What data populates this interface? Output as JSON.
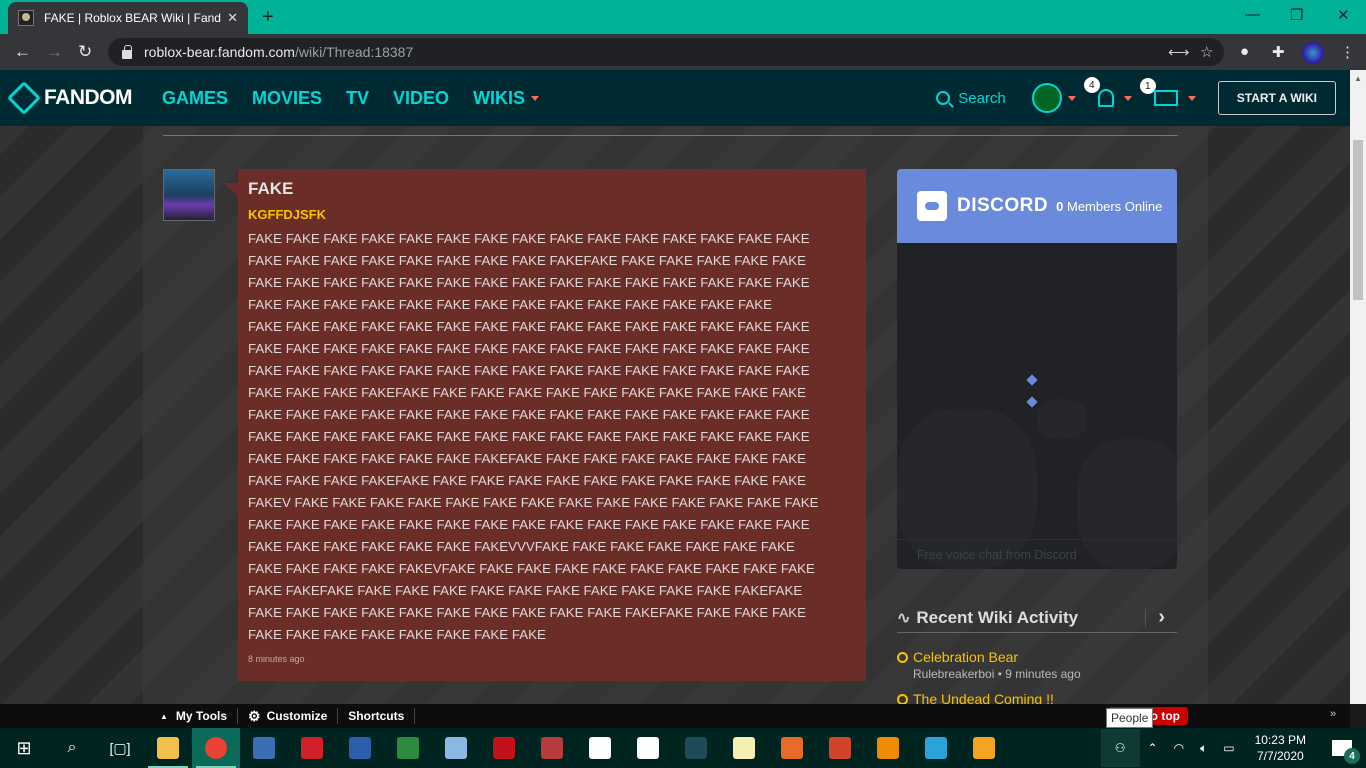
{
  "browser": {
    "tab_title": "FAKE | Roblox BEAR Wiki | Fandom",
    "url_host": "roblox-bear.fandom.com",
    "url_path": "/wiki/Thread:18387",
    "new_tab_label": "+",
    "tab_close": "✕",
    "minimize": "—",
    "restore": "❐",
    "close": "✕",
    "back": "←",
    "forward": "→",
    "reload": "↻",
    "translate_icon": "⟷",
    "star_icon": "☆",
    "ext_icon": "●",
    "puzzle_icon": "✚",
    "menu_icon": "⋮"
  },
  "nav": {
    "brand": "FANDOM",
    "links": [
      "GAMES",
      "MOVIES",
      "TV",
      "VIDEO",
      "WIKIS"
    ],
    "search_label": "Search",
    "notifications_count": "4",
    "messages_count": "1",
    "start_wiki": "START A WIKI"
  },
  "post": {
    "title": "FAKE",
    "author": "KGFFDJSFK",
    "lines": [
      "FAKE FAKE FAKE FAKE FAKE FAKE FAKE FAKE FAKE FAKE FAKE FAKE FAKE FAKE FAKE",
      "FAKE FAKE FAKE FAKE FAKE FAKE FAKE FAKE FAKEFAKE FAKE FAKE FAKE FAKE FAKE",
      "FAKE FAKE FAKE FAKE FAKE FAKE FAKE FAKE FAKE FAKE FAKE FAKE FAKE FAKE FAKE",
      "FAKE FAKE FAKE FAKE FAKE FAKE FAKE FAKE FAKE FAKE FAKE FAKE FAKE FAKE",
      "FAKE FAKE FAKE FAKE FAKE FAKE FAKE FAKE FAKE FAKE FAKE FAKE FAKE FAKE FAKE",
      "FAKE FAKE FAKE FAKE FAKE FAKE FAKE FAKE FAKE FAKE FAKE FAKE FAKE FAKE FAKE",
      "FAKE FAKE FAKE FAKE FAKE FAKE FAKE FAKE FAKE FAKE FAKE FAKE FAKE FAKE FAKE",
      "FAKE FAKE FAKE FAKEFAKE FAKE FAKE FAKE FAKE FAKE FAKE FAKE FAKE FAKE FAKE",
      "FAKE FAKE FAKE FAKE FAKE FAKE FAKE FAKE FAKE FAKE FAKE FAKE FAKE FAKE FAKE",
      "FAKE FAKE FAKE FAKE FAKE FAKE FAKE FAKE FAKE FAKE FAKE FAKE FAKE FAKE FAKE",
      "FAKE FAKE FAKE FAKE FAKE FAKE FAKEFAKE FAKE FAKE FAKE FAKE FAKE FAKE FAKE",
      "FAKE FAKE FAKE FAKEFAKE FAKE FAKE FAKE FAKE FAKE FAKE FAKE FAKE FAKE FAKE",
      "FAKEV FAKE FAKE FAKE FAKE FAKE FAKE FAKE FAKE FAKE FAKE FAKE FAKE FAKE FAKE",
      "FAKE FAKE FAKE FAKE FAKE FAKE FAKE FAKE FAKE FAKE FAKE FAKE FAKE FAKE FAKE",
      "FAKE FAKE FAKE FAKE FAKE FAKE FAKEVVVFAKE FAKE FAKE FAKE FAKE FAKE FAKE",
      "FAKE FAKE FAKE FAKE FAKEVFAKE FAKE FAKE FAKE FAKE FAKE FAKE FAKE FAKE FAKE",
      "FAKE FAKEFAKE FAKE FAKE FAKE FAKE FAKE FAKE FAKE FAKE FAKE FAKE FAKEFAKE",
      "FAKE FAKE FAKE FAKE FAKE FAKE FAKE FAKE FAKE FAKE FAKEFAKE FAKE FAKE FAKE",
      "FAKE FAKE FAKE FAKE FAKE FAKE FAKE FAKE"
    ],
    "timestamp": "8 minutes ago"
  },
  "discord": {
    "wordmark": "DISCORD",
    "members_count": "0",
    "members_label": "Members Online",
    "footer": "Free voice chat from Discord"
  },
  "recent_activity": {
    "title": "Recent Wiki Activity",
    "items": [
      {
        "title": "Celebration Bear",
        "meta": "Rulebreakerboi • 9 minutes ago"
      },
      {
        "title": "The Undead Coming !!",
        "meta": ""
      }
    ]
  },
  "wiki_toolbar": {
    "my_tools": "My Tools",
    "customize": "Customize",
    "shortcuts": "Shortcuts",
    "back_to_top": "Back to top",
    "tooltip": "People"
  },
  "taskbar": {
    "apps": [
      {
        "name": "file-explorer",
        "color": "#f3c14b"
      },
      {
        "name": "chrome",
        "color": "#e94235"
      },
      {
        "name": "remote-desktop",
        "color": "#3a6fb6"
      },
      {
        "name": "rsa",
        "color": "#d0202a"
      },
      {
        "name": "word",
        "color": "#2b5fab"
      },
      {
        "name": "excel",
        "color": "#2d8a3e"
      },
      {
        "name": "paint",
        "color": "#8ab8e0"
      },
      {
        "name": "acrobat",
        "color": "#c1121c"
      },
      {
        "name": "access",
        "color": "#b83b3b"
      },
      {
        "name": "calculator",
        "color": "#ffffff"
      },
      {
        "name": "camera",
        "color": "#ffffff"
      },
      {
        "name": "app-eye",
        "color": "#1f4a5a"
      },
      {
        "name": "app-d",
        "color": "#f5efb3"
      },
      {
        "name": "media-player-classic",
        "color": "#e86b2a"
      },
      {
        "name": "powerpoint",
        "color": "#d0442b"
      },
      {
        "name": "vlc",
        "color": "#f08a00"
      },
      {
        "name": "people-app",
        "color": "#2aa3dd"
      },
      {
        "name": "app-orange",
        "color": "#f3a521"
      }
    ],
    "time": "10:23 PM",
    "date": "7/7/2020",
    "notifications": "4"
  }
}
